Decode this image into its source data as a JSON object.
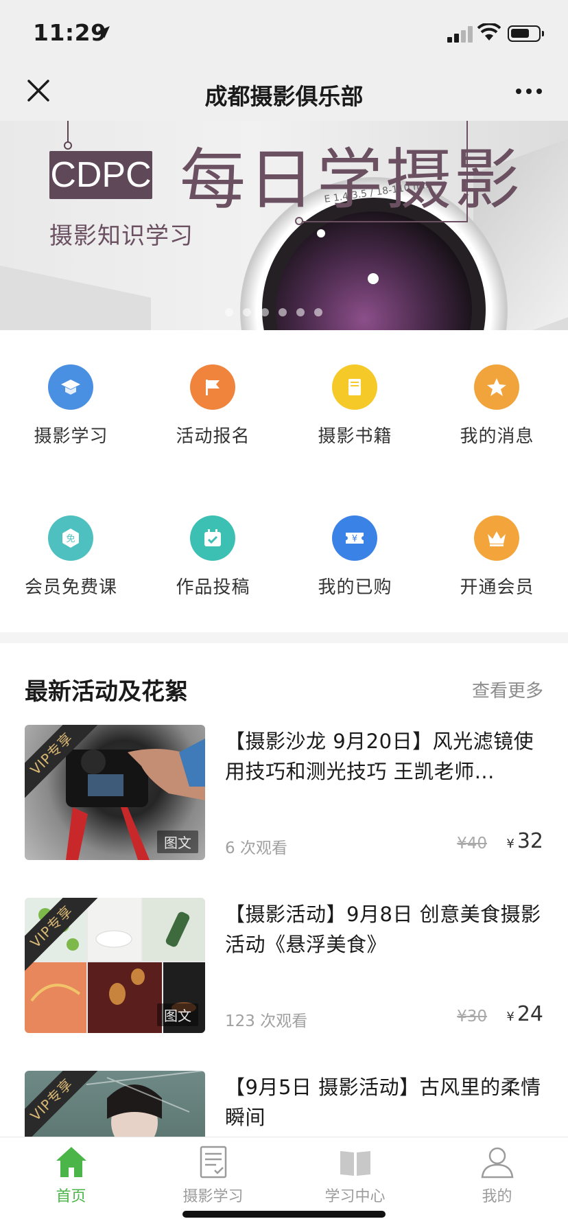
{
  "status_bar": {
    "time": "11:29"
  },
  "nav": {
    "title": "成都摄影俱乐部"
  },
  "banner": {
    "badge": "CDPC",
    "heading": "每日学摄影",
    "subtitle": "摄影知识学习",
    "lens_text": "E 1.4-3.5 / 18-110 mm"
  },
  "grid": {
    "items": [
      {
        "label": "摄影学习",
        "icon": "graduation-cap-icon",
        "color": "#4a90e2"
      },
      {
        "label": "活动报名",
        "icon": "flag-icon",
        "color": "#f0843c"
      },
      {
        "label": "摄影书籍",
        "icon": "book-icon",
        "color": "#f5c928"
      },
      {
        "label": "我的消息",
        "icon": "star-icon",
        "color": "#f2a43c"
      },
      {
        "label": "会员免费课",
        "icon": "free-badge-icon",
        "color": "#4ec0c0",
        "badge_text": "免"
      },
      {
        "label": "作品投稿",
        "icon": "calendar-check-icon",
        "color": "#3cc0b4"
      },
      {
        "label": "我的已购",
        "icon": "ticket-icon",
        "color": "#3b82e6",
        "badge_text": "¥"
      },
      {
        "label": "开通会员",
        "icon": "crown-icon",
        "color": "#f3a43a"
      }
    ]
  },
  "section": {
    "title": "最新活动及花絮",
    "more": "查看更多"
  },
  "cards": [
    {
      "vip": "VIP专享",
      "type": "图文",
      "title": "【摄影沙龙 9月20日】风光滤镜使用技巧和测光技巧 王凯老师...",
      "views": "6 次观看",
      "old_price": "¥40",
      "price_symbol": "¥",
      "price": "32"
    },
    {
      "vip": "VIP专享",
      "type": "图文",
      "title": "【摄影活动】9月8日 创意美食摄影活动《悬浮美食》",
      "views": "123 次观看",
      "old_price": "¥30",
      "price_symbol": "¥",
      "price": "24"
    },
    {
      "vip": "VIP专享",
      "title": "【9月5日 摄影活动】古风里的柔情瞬间"
    }
  ],
  "tabs": [
    {
      "label": "首页",
      "icon": "home-icon",
      "active": true
    },
    {
      "label": "摄影学习",
      "icon": "document-icon",
      "active": false
    },
    {
      "label": "学习中心",
      "icon": "open-book-icon",
      "active": false
    },
    {
      "label": "我的",
      "icon": "user-icon",
      "active": false
    }
  ],
  "colors": {
    "accent_green": "#4cb54a",
    "banner_purple": "#5f4857",
    "vip_gold": "#d9b774"
  }
}
